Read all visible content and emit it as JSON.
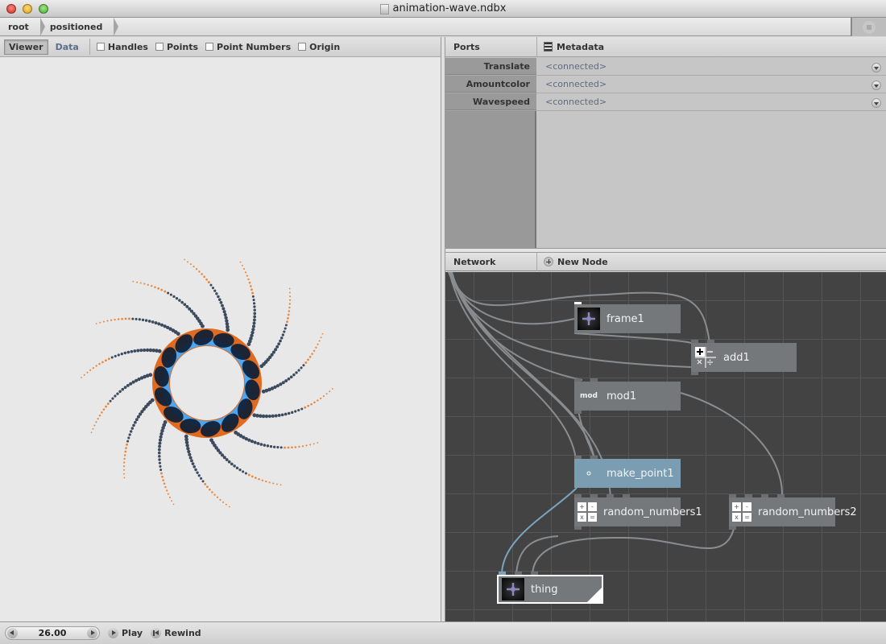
{
  "window": {
    "title": "animation-wave.ndbx"
  },
  "breadcrumb": [
    "root",
    "positioned"
  ],
  "viewer": {
    "tabs": [
      {
        "label": "Viewer",
        "active": true
      },
      {
        "label": "Data",
        "active": false
      }
    ],
    "checkboxes": [
      {
        "label": "Handles",
        "checked": false
      },
      {
        "label": "Points",
        "checked": false
      },
      {
        "label": "Point Numbers",
        "checked": false
      },
      {
        "label": "Origin",
        "checked": false
      }
    ],
    "colors": {
      "ring_outer": "#e06a1f",
      "ring_inner": "#4ea6f0",
      "blob": "#0c1e35",
      "tail": "#3c4a5e",
      "tail_tip": "#e8883f"
    }
  },
  "ports": {
    "tab_label": "Ports",
    "metadata_label": "Metadata",
    "rows": [
      {
        "name": "Translate",
        "value": "<connected>"
      },
      {
        "name": "Amountcolor",
        "value": "<connected>"
      },
      {
        "name": "Wavespeed",
        "value": "<connected>"
      }
    ]
  },
  "network": {
    "tab_label": "Network",
    "new_node_label": "New Node",
    "nodes": [
      {
        "name": "frame1",
        "icon": "move"
      },
      {
        "name": "add1",
        "icon": "math"
      },
      {
        "name": "mod1",
        "icon": "mod",
        "icon_text": "mod"
      },
      {
        "name": "make_point1",
        "icon": "point",
        "selected": true
      },
      {
        "name": "random_numbers1",
        "icon": "random"
      },
      {
        "name": "random_numbers2",
        "icon": "random"
      },
      {
        "name": "thing",
        "icon": "move",
        "rendered": true
      }
    ]
  },
  "playback": {
    "frame": "26.00",
    "play_label": "Play",
    "rewind_label": "Rewind"
  }
}
